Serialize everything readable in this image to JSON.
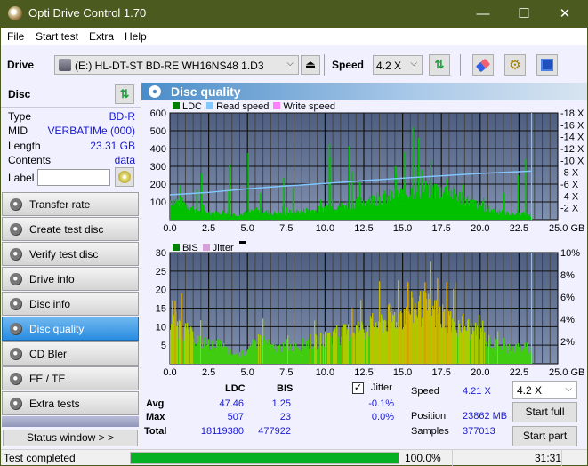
{
  "window": {
    "title": "Opti Drive Control 1.70",
    "minimize": "—",
    "maximize": "☐",
    "close": "✕"
  },
  "menu": [
    "File",
    "Start test",
    "Extra",
    "Help"
  ],
  "toolbar": {
    "drive_label": "Drive",
    "drive_value": "(E:)  HL-DT-ST BD-RE  WH16NS48 1.D3",
    "speed_label": "Speed",
    "speed_value": "4.2 X",
    "icons": [
      "eject-icon",
      "refresh-icon",
      "eraser-icon",
      "settings-icon",
      "save-icon"
    ]
  },
  "disc": {
    "header": "Disc",
    "fields": [
      {
        "key": "Type",
        "value": "BD-R"
      },
      {
        "key": "MID",
        "value": "VERBATIMe (000)"
      },
      {
        "key": "Length",
        "value": "23.31 GB"
      },
      {
        "key": "Contents",
        "value": "data"
      }
    ],
    "label_key": "Label",
    "label_value": ""
  },
  "nav": [
    {
      "label": "Transfer rate",
      "active": false
    },
    {
      "label": "Create test disc",
      "active": false
    },
    {
      "label": "Verify test disc",
      "active": false
    },
    {
      "label": "Drive info",
      "active": false
    },
    {
      "label": "Disc info",
      "active": false
    },
    {
      "label": "Disc quality",
      "active": true
    },
    {
      "label": "CD Bler",
      "active": false
    },
    {
      "label": "FE / TE",
      "active": false
    },
    {
      "label": "Extra tests",
      "active": false
    }
  ],
  "status_window_btn": "Status window > >",
  "panel": {
    "title": "Disc quality"
  },
  "colors": {
    "ldc": "#00c000",
    "read_speed": "#80c8ff",
    "write_speed": "#ff80ff",
    "bis": "#008000",
    "jitter": "#d8a0d8",
    "plot_bg_top": "#4e5e80",
    "plot_bg_bottom": "#8090b0",
    "accent_blue": "#1a1ad0",
    "progress": "#06b025"
  },
  "chart_data": [
    {
      "type": "bar",
      "title": "LDC",
      "legend": [
        "LDC",
        "Read speed",
        "Write speed"
      ],
      "xlabel": "GB",
      "x_ticks": [
        "0.0",
        "2.5",
        "5.0",
        "7.5",
        "10.0",
        "12.5",
        "15.0",
        "17.5",
        "20.0",
        "22.5",
        "25.0 GB"
      ],
      "y_ticks_left": [
        "600",
        "500",
        "400",
        "300",
        "200",
        "100"
      ],
      "y_ticks_right": [
        "18 X",
        "16 X",
        "14 X",
        "12 X",
        "10 X",
        "8 X",
        "6 X",
        "4 X",
        "2 X"
      ],
      "xlim": [
        0,
        25
      ],
      "ylim": [
        0,
        600
      ],
      "y2lim": [
        0,
        18
      ],
      "end_marker_x": 23.31,
      "ldc_envelope": [
        [
          0,
          130
        ],
        [
          0.5,
          120
        ],
        [
          1,
          100
        ],
        [
          1.5,
          70
        ],
        [
          2,
          55
        ],
        [
          2.5,
          45
        ],
        [
          3,
          45
        ],
        [
          3.5,
          50
        ],
        [
          4,
          30
        ],
        [
          4.5,
          35
        ],
        [
          5,
          45
        ],
        [
          5.5,
          55
        ],
        [
          6,
          60
        ],
        [
          6.5,
          40
        ],
        [
          7,
          45
        ],
        [
          7.5,
          50
        ],
        [
          8,
          55
        ],
        [
          8.5,
          55
        ],
        [
          9,
          60
        ],
        [
          9.5,
          65
        ],
        [
          10,
          80
        ],
        [
          10.5,
          90
        ],
        [
          11,
          95
        ],
        [
          11.5,
          100
        ],
        [
          12,
          115
        ],
        [
          12.5,
          120
        ],
        [
          13,
          130
        ],
        [
          13.5,
          145
        ],
        [
          14,
          150
        ],
        [
          14.5,
          160
        ],
        [
          15,
          175
        ],
        [
          15.5,
          185
        ],
        [
          16,
          200
        ],
        [
          16.5,
          200
        ],
        [
          17,
          195
        ],
        [
          17.5,
          190
        ],
        [
          18,
          175
        ],
        [
          18.5,
          160
        ],
        [
          19,
          135
        ],
        [
          19.5,
          110
        ],
        [
          20,
          90
        ],
        [
          20.5,
          70
        ],
        [
          21,
          55
        ],
        [
          21.5,
          50
        ],
        [
          22,
          35
        ],
        [
          22.5,
          40
        ],
        [
          23,
          40
        ],
        [
          23.31,
          20
        ]
      ],
      "ldc_spikes": [
        [
          1.7,
          170
        ],
        [
          2.0,
          260
        ],
        [
          3.8,
          310
        ],
        [
          3.75,
          160
        ],
        [
          5.0,
          375
        ],
        [
          5.8,
          150
        ],
        [
          7.3,
          235
        ],
        [
          7.9,
          180
        ],
        [
          10.2,
          425
        ],
        [
          10.3,
          350
        ],
        [
          11.5,
          415
        ],
        [
          11.7,
          270
        ],
        [
          12.2,
          210
        ],
        [
          14.5,
          300
        ],
        [
          15.1,
          380
        ],
        [
          15.6,
          520
        ],
        [
          16.0,
          460
        ],
        [
          16.2,
          280
        ],
        [
          17.8,
          230
        ],
        [
          21.5,
          150
        ],
        [
          22.4,
          250
        ],
        [
          22.9,
          340
        ]
      ],
      "read_speed": [
        [
          0,
          4.2
        ],
        [
          2.5,
          4.6
        ],
        [
          5,
          5.2
        ],
        [
          7.5,
          5.7
        ],
        [
          10,
          6.1
        ],
        [
          12.5,
          6.6
        ],
        [
          15,
          7.0
        ],
        [
          17.5,
          7.4
        ],
        [
          20,
          7.8
        ],
        [
          22.5,
          8.1
        ],
        [
          23.31,
          8.2
        ]
      ]
    },
    {
      "type": "bar",
      "title": "BIS",
      "legend": [
        "BIS",
        "Jitter"
      ],
      "xlabel": "GB",
      "x_ticks": [
        "0.0",
        "2.5",
        "5.0",
        "7.5",
        "10.0",
        "12.5",
        "15.0",
        "17.5",
        "20.0",
        "22.5",
        "25.0 GB"
      ],
      "y_ticks_left": [
        "30",
        "25",
        "20",
        "15",
        "10",
        "5"
      ],
      "y_ticks_right": [
        "10%",
        "8%",
        "6%",
        "4%",
        "2%"
      ],
      "xlim": [
        0,
        25
      ],
      "ylim": [
        0,
        30
      ],
      "y2lim": [
        0,
        10
      ],
      "end_marker_x": 23.31,
      "bis_envelope": [
        [
          0,
          13
        ],
        [
          0.5,
          12
        ],
        [
          1,
          10
        ],
        [
          1.5,
          8
        ],
        [
          2,
          7
        ],
        [
          2.5,
          6
        ],
        [
          3,
          6
        ],
        [
          3.5,
          5
        ],
        [
          4,
          3
        ],
        [
          4.5,
          3
        ],
        [
          5,
          4
        ],
        [
          5.5,
          7
        ],
        [
          6,
          8
        ],
        [
          6.5,
          5
        ],
        [
          7,
          5
        ],
        [
          7.5,
          5
        ],
        [
          8,
          6
        ],
        [
          8.5,
          6
        ],
        [
          9,
          7
        ],
        [
          9.5,
          7
        ],
        [
          10,
          8
        ],
        [
          10.5,
          9
        ],
        [
          11,
          9
        ],
        [
          11.5,
          10
        ],
        [
          12,
          11
        ],
        [
          12.5,
          11
        ],
        [
          13,
          12
        ],
        [
          13.5,
          13
        ],
        [
          14,
          14
        ],
        [
          14.5,
          15
        ],
        [
          15,
          16
        ],
        [
          15.5,
          17
        ],
        [
          16,
          18
        ],
        [
          16.5,
          17
        ],
        [
          17,
          16
        ],
        [
          17.5,
          15
        ],
        [
          18,
          14
        ],
        [
          18.5,
          13
        ],
        [
          19,
          12
        ],
        [
          19.5,
          10
        ],
        [
          20,
          9
        ],
        [
          20.5,
          7
        ],
        [
          21,
          6
        ],
        [
          21.5,
          5
        ],
        [
          22,
          5
        ],
        [
          22.5,
          5
        ],
        [
          23,
          5
        ],
        [
          23.31,
          4
        ]
      ],
      "bis_spikes": [
        [
          0.3,
          17
        ],
        [
          0.7,
          19
        ],
        [
          11.7,
          15
        ],
        [
          15.3,
          22
        ],
        [
          16.4,
          22
        ],
        [
          17.2,
          23
        ],
        [
          17.8,
          22
        ]
      ]
    }
  ],
  "stats": {
    "col_ldc": "LDC",
    "col_bis": "BIS",
    "rows": [
      {
        "label": "Avg",
        "ldc": "47.46",
        "bis": "1.25",
        "jitter": "-0.1%"
      },
      {
        "label": "Max",
        "ldc": "507",
        "bis": "23",
        "jitter": "0.0%"
      },
      {
        "label": "Total",
        "ldc": "18119380",
        "bis": "477922"
      }
    ],
    "jitter_label": "Jitter",
    "jitter_checked": true,
    "speed_label": "Speed",
    "speed_value": "4.21 X",
    "position_label": "Position",
    "position_value": "23862 MB",
    "samples_label": "Samples",
    "samples_value": "377013",
    "speed_select": "4.2 X",
    "start_full": "Start full",
    "start_part": "Start part"
  },
  "statusbar": {
    "text": "Test completed",
    "progress_percent": 100.0,
    "progress_label": "100.0%",
    "elapsed": "31:31"
  }
}
